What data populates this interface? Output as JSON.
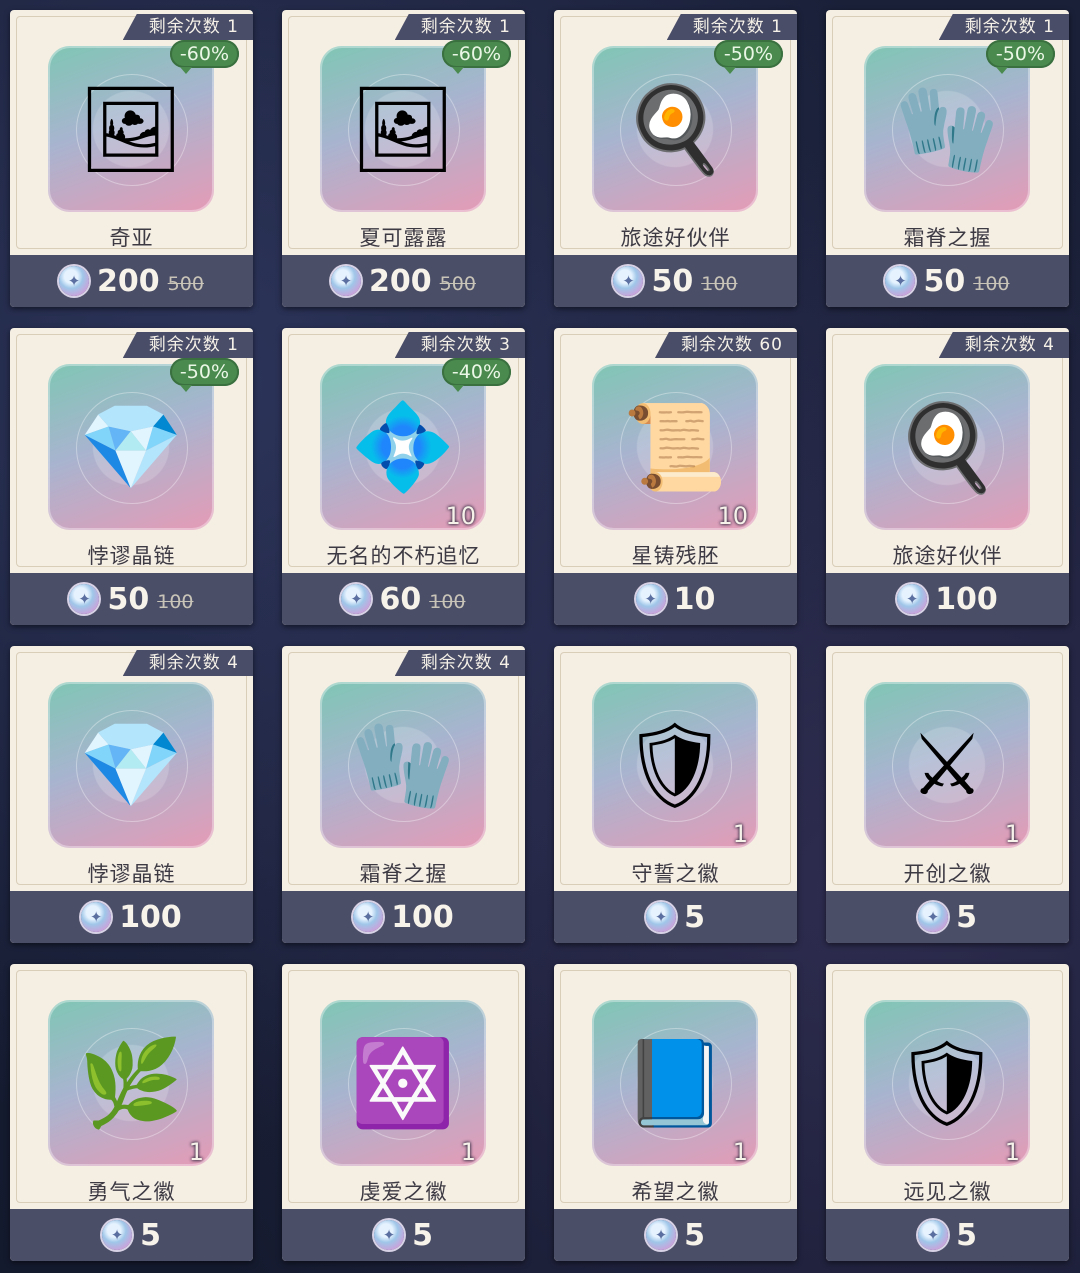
{
  "labels": {
    "remaining_prefix": "剩余次数"
  },
  "currency_icon": "crystal-icon",
  "items": [
    {
      "name": "奇亚",
      "remaining": "1",
      "discount": "-60%",
      "price": "200",
      "old_price": "500",
      "qty": "",
      "icon": "portrait-frame-icon",
      "glyph": "🖼"
    },
    {
      "name": "夏可露露",
      "remaining": "1",
      "discount": "-60%",
      "price": "200",
      "old_price": "500",
      "qty": "",
      "icon": "portrait-frame-icon",
      "glyph": "🖼"
    },
    {
      "name": "旅途好伙伴",
      "remaining": "1",
      "discount": "-50%",
      "price": "50",
      "old_price": "100",
      "qty": "",
      "icon": "frying-pan-icon",
      "glyph": "🍳"
    },
    {
      "name": "霜脊之握",
      "remaining": "1",
      "discount": "-50%",
      "price": "50",
      "old_price": "100",
      "qty": "",
      "icon": "gauntlet-icon",
      "glyph": "🧤"
    },
    {
      "name": "悖谬晶链",
      "remaining": "1",
      "discount": "-50%",
      "price": "50",
      "old_price": "100",
      "qty": "",
      "icon": "crystal-chain-icon",
      "glyph": "💎"
    },
    {
      "name": "无名的不朽追忆",
      "remaining": "3",
      "discount": "-40%",
      "price": "60",
      "old_price": "100",
      "qty": "10",
      "icon": "crystal-cluster-icon",
      "glyph": "💠"
    },
    {
      "name": "星铸残胚",
      "remaining": "60",
      "discount": "",
      "price": "10",
      "old_price": "",
      "qty": "10",
      "icon": "tablet-icon",
      "glyph": "📜"
    },
    {
      "name": "旅途好伙伴",
      "remaining": "4",
      "discount": "",
      "price": "100",
      "old_price": "",
      "qty": "",
      "icon": "frying-pan-icon",
      "glyph": "🍳"
    },
    {
      "name": "悖谬晶链",
      "remaining": "4",
      "discount": "",
      "price": "100",
      "old_price": "",
      "qty": "",
      "icon": "crystal-chain-icon",
      "glyph": "💎"
    },
    {
      "name": "霜脊之握",
      "remaining": "4",
      "discount": "",
      "price": "100",
      "old_price": "",
      "qty": "",
      "icon": "gauntlet-icon",
      "glyph": "🧤"
    },
    {
      "name": "守誓之徽",
      "remaining": "",
      "discount": "",
      "price": "5",
      "old_price": "",
      "qty": "1",
      "icon": "shield-axe-emblem-icon",
      "glyph": "🛡"
    },
    {
      "name": "开创之徽",
      "remaining": "",
      "discount": "",
      "price": "5",
      "old_price": "",
      "qty": "1",
      "icon": "sword-emblem-icon",
      "glyph": "⚔"
    },
    {
      "name": "勇气之徽",
      "remaining": "",
      "discount": "",
      "price": "5",
      "old_price": "",
      "qty": "1",
      "icon": "leaf-gem-emblem-icon",
      "glyph": "🌿"
    },
    {
      "name": "虔爱之徽",
      "remaining": "",
      "discount": "",
      "price": "5",
      "old_price": "",
      "qty": "1",
      "icon": "star-gem-emblem-icon",
      "glyph": "🔯"
    },
    {
      "name": "希望之徽",
      "remaining": "",
      "discount": "",
      "price": "5",
      "old_price": "",
      "qty": "1",
      "icon": "book-orb-emblem-icon",
      "glyph": "📘"
    },
    {
      "name": "远见之徽",
      "remaining": "",
      "discount": "",
      "price": "5",
      "old_price": "",
      "qty": "1",
      "icon": "winged-shield-emblem-icon",
      "glyph": "🛡"
    }
  ]
}
